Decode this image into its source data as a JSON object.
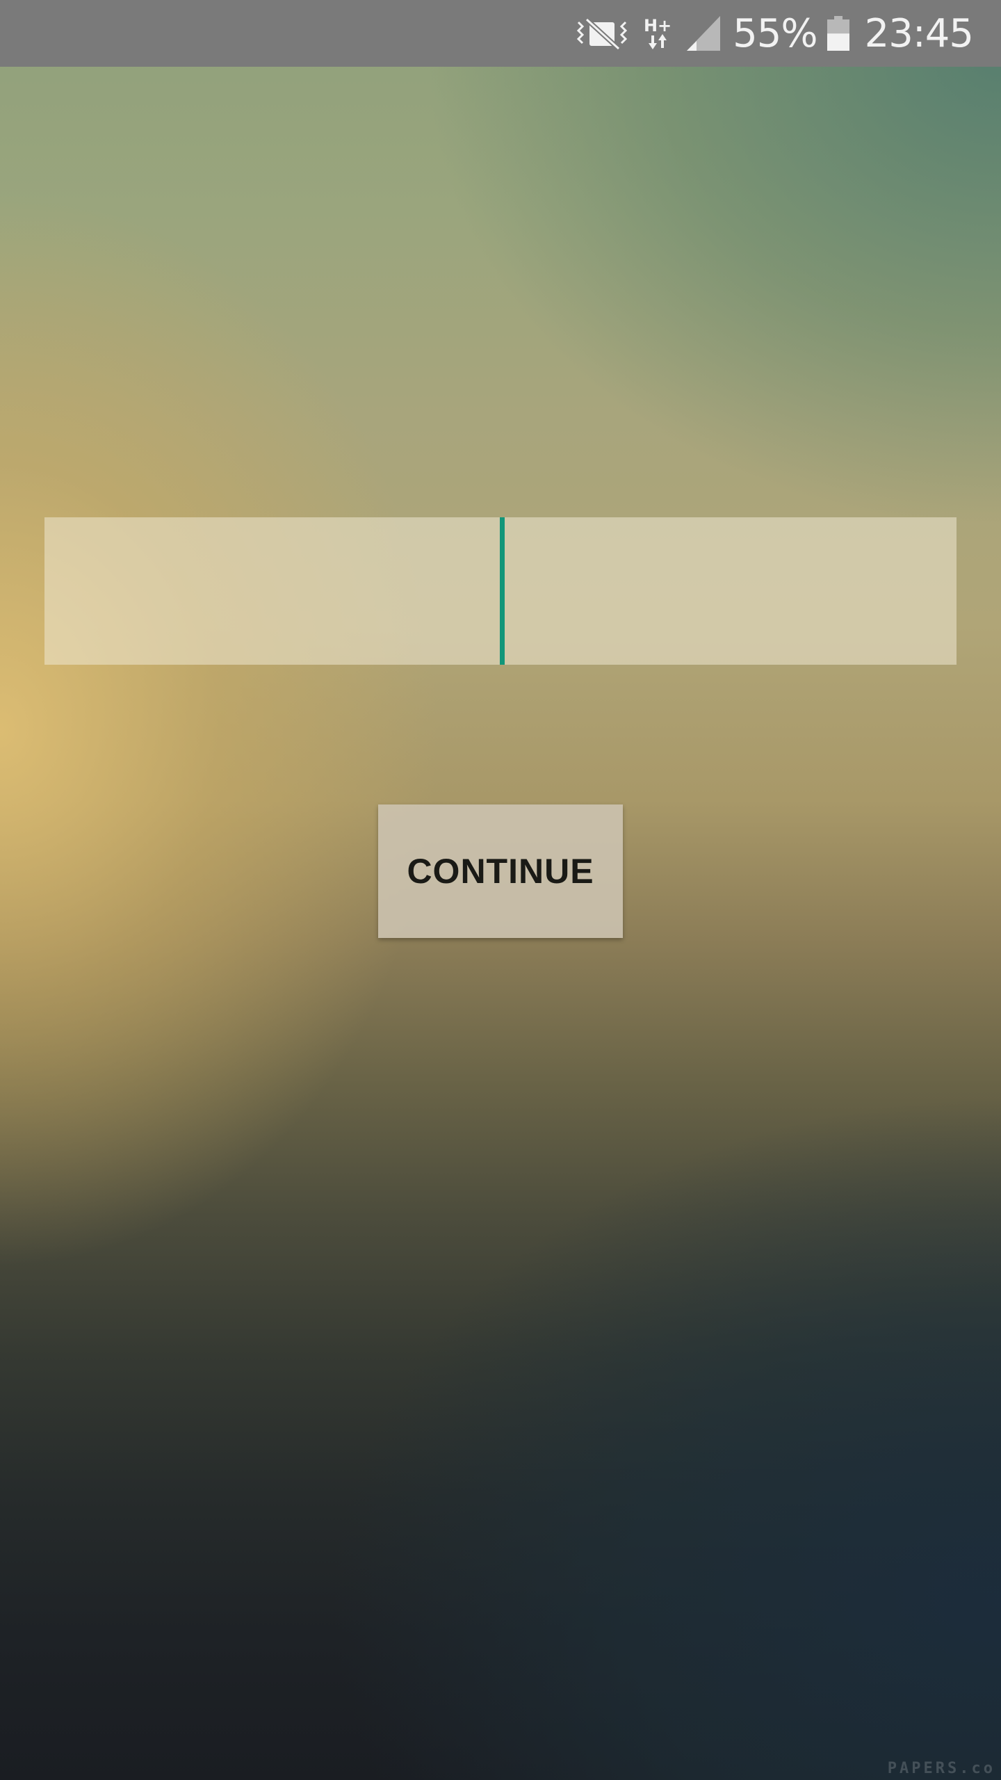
{
  "status_bar": {
    "icons": [
      "vibrate-mute-icon",
      "hplus-data-icon",
      "signal-icon",
      "battery-icon"
    ],
    "network_type": "H+",
    "battery_percent": "55%",
    "battery_level": 0.55,
    "time": "23:45"
  },
  "form": {
    "input_value": "",
    "continue_label": "CONTINUE"
  },
  "watermark": "PAPERS.co",
  "colors": {
    "cursor": "#129679",
    "status_bar_bg": "#7a7a7a"
  }
}
